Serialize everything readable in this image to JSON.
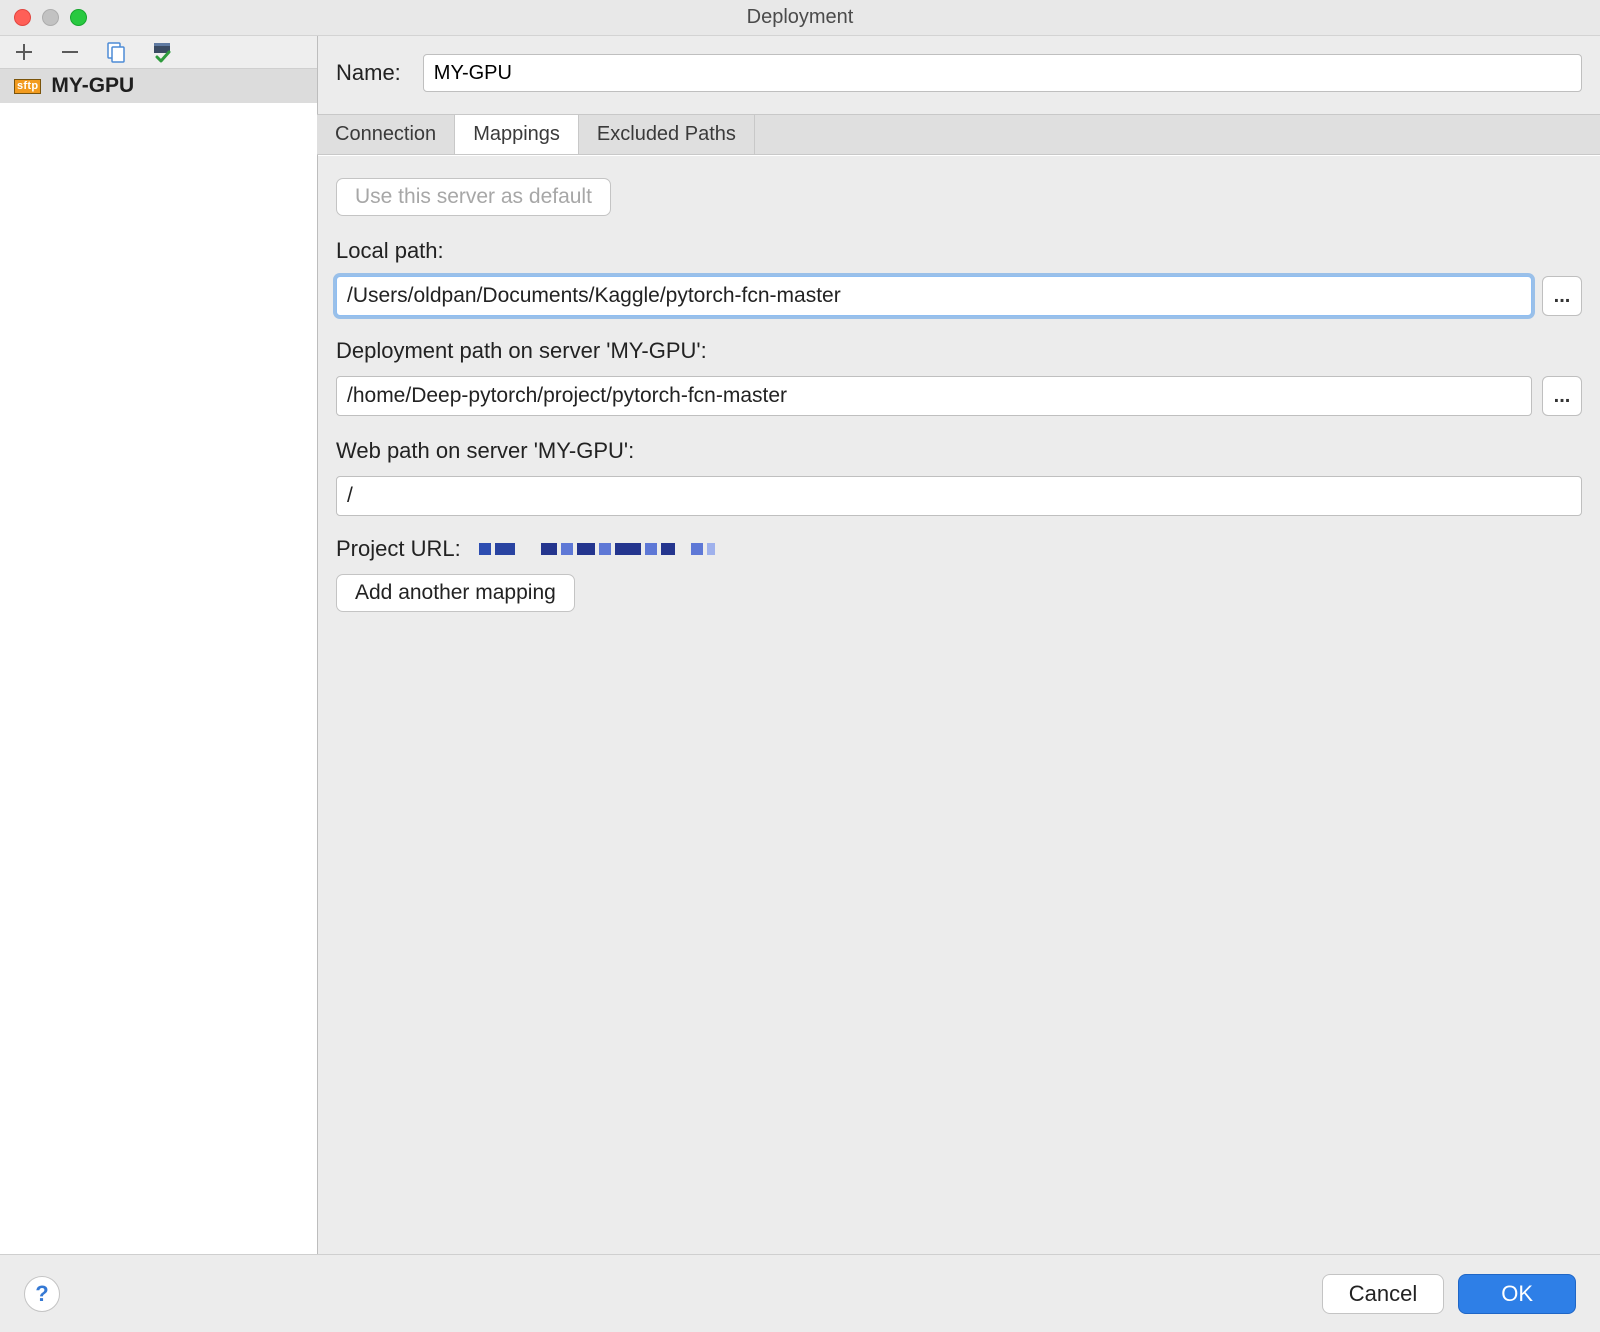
{
  "window": {
    "title": "Deployment"
  },
  "sidebar": {
    "badge": "sftp",
    "items": [
      {
        "label": "MY-GPU"
      }
    ]
  },
  "namerow": {
    "label": "Name:",
    "value": "MY-GPU"
  },
  "tabs": [
    {
      "label": "Connection"
    },
    {
      "label": "Mappings"
    },
    {
      "label": "Excluded Paths"
    }
  ],
  "content": {
    "default_button": "Use this server as default",
    "local_path_label": "Local path:",
    "local_path_value": "/Users/oldpan/Documents/Kaggle/pytorch-fcn-master",
    "deploy_path_label": "Deployment path on server 'MY-GPU':",
    "deploy_path_value": "/home/Deep-pytorch/project/pytorch-fcn-master",
    "web_path_label": "Web path on server 'MY-GPU':",
    "web_path_value": "/",
    "project_url_label": "Project URL:",
    "add_mapping": "Add another mapping",
    "browse": "..."
  },
  "footer": {
    "help": "?",
    "cancel": "Cancel",
    "ok": "OK"
  }
}
